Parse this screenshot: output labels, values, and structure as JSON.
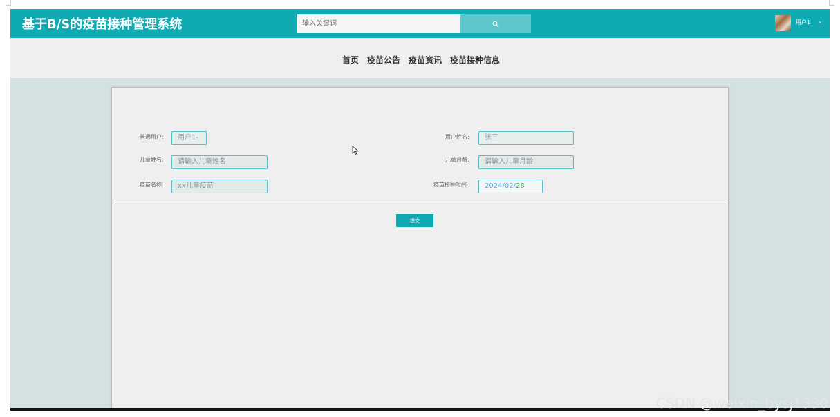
{
  "header": {
    "site_title": "基于B/S的疫苗接种管理系统",
    "search_placeholder": "输入关键词",
    "user_name": "用户1",
    "user_caret": "⌄"
  },
  "nav": {
    "items": [
      {
        "label": "首页"
      },
      {
        "label": "疫苗公告"
      },
      {
        "label": "疫苗资讯"
      },
      {
        "label": "疫苗接种信息"
      }
    ]
  },
  "form": {
    "normal_user": {
      "label": "普通用户:",
      "value": "用户1-"
    },
    "user_name": {
      "label": "用户姓名:",
      "value": "张三"
    },
    "child_name": {
      "label": "儿童姓名:",
      "placeholder": "请输入儿童姓名"
    },
    "child_age": {
      "label": "儿童月龄:",
      "placeholder": "请输入儿童月龄"
    },
    "vaccine_name": {
      "label": "疫苗名称:",
      "value": "xx儿童疫苗"
    },
    "vaccination_time": {
      "label": "疫苗接种时间:",
      "year": "2024",
      "month": "02",
      "day": "28",
      "separator": "/"
    },
    "submit_label": "提交"
  },
  "watermark": "CSDN @weixin_bysj1330",
  "colors": {
    "primary": "#10aab2",
    "search_button": "#5ec7ce",
    "page_background": "#d4e1e2",
    "nav_background": "#efefef",
    "field_border": "#58bec4",
    "date_blue": "#57a7ea",
    "date_green": "#35b44a"
  },
  "icons": {
    "search": "search-icon",
    "avatar": "avatar",
    "cursor": "mouse-cursor-icon"
  }
}
